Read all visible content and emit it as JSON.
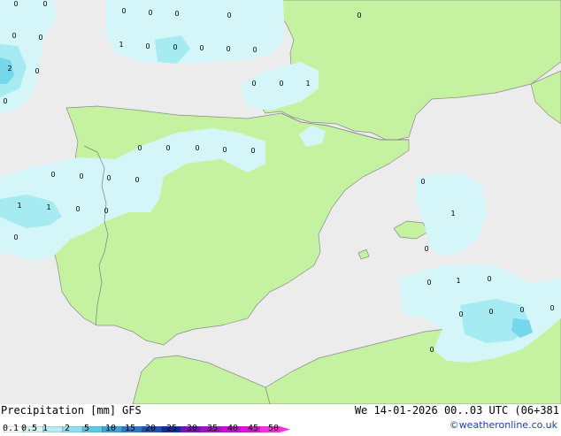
{
  "legend": {
    "title": "Precipitation [mm]",
    "model": "GFS",
    "valid_time": "We 14-01-2026 00..03 UTC (06+381",
    "credit": "©weatheronline.co.uk",
    "scale_values": [
      "0.1",
      "0.5",
      "1",
      "2",
      "5",
      "10",
      "15",
      "20",
      "25",
      "30",
      "35",
      "40",
      "45",
      "50"
    ],
    "scale_colors": [
      "#fefefe",
      "#d8f5f5",
      "#b4ecf3",
      "#8ee0ef",
      "#5cc8e8",
      "#39a4dd",
      "#2b78cf",
      "#1d4fbc",
      "#0f2aa8",
      "#7b0fc0",
      "#a00fcf",
      "#c50fd8",
      "#e30fdc",
      "#fe2ee2"
    ]
  },
  "map": {
    "colors": {
      "sea": "#ececec",
      "land": "#c4f2a0",
      "rain_light": "#d4f6f8",
      "rain_moderate": "#a6ebf2",
      "rain_heavy": "#74d7eb",
      "border": "#7f7f7f"
    },
    "value_labels": [
      "0",
      "0",
      "0",
      "0",
      "0",
      "0",
      "0",
      "0",
      "0",
      "1",
      "0",
      "0",
      "0",
      "0",
      "0",
      "0",
      "2",
      "0",
      "0",
      "0",
      "1",
      "0",
      "0",
      "0",
      "0",
      "0",
      "0",
      "0",
      "0",
      "0",
      "0",
      "1",
      "1",
      "0",
      "0",
      "1",
      "0",
      "0",
      "0",
      "1",
      "0",
      "0",
      "0",
      "0",
      "0",
      "0"
    ]
  }
}
